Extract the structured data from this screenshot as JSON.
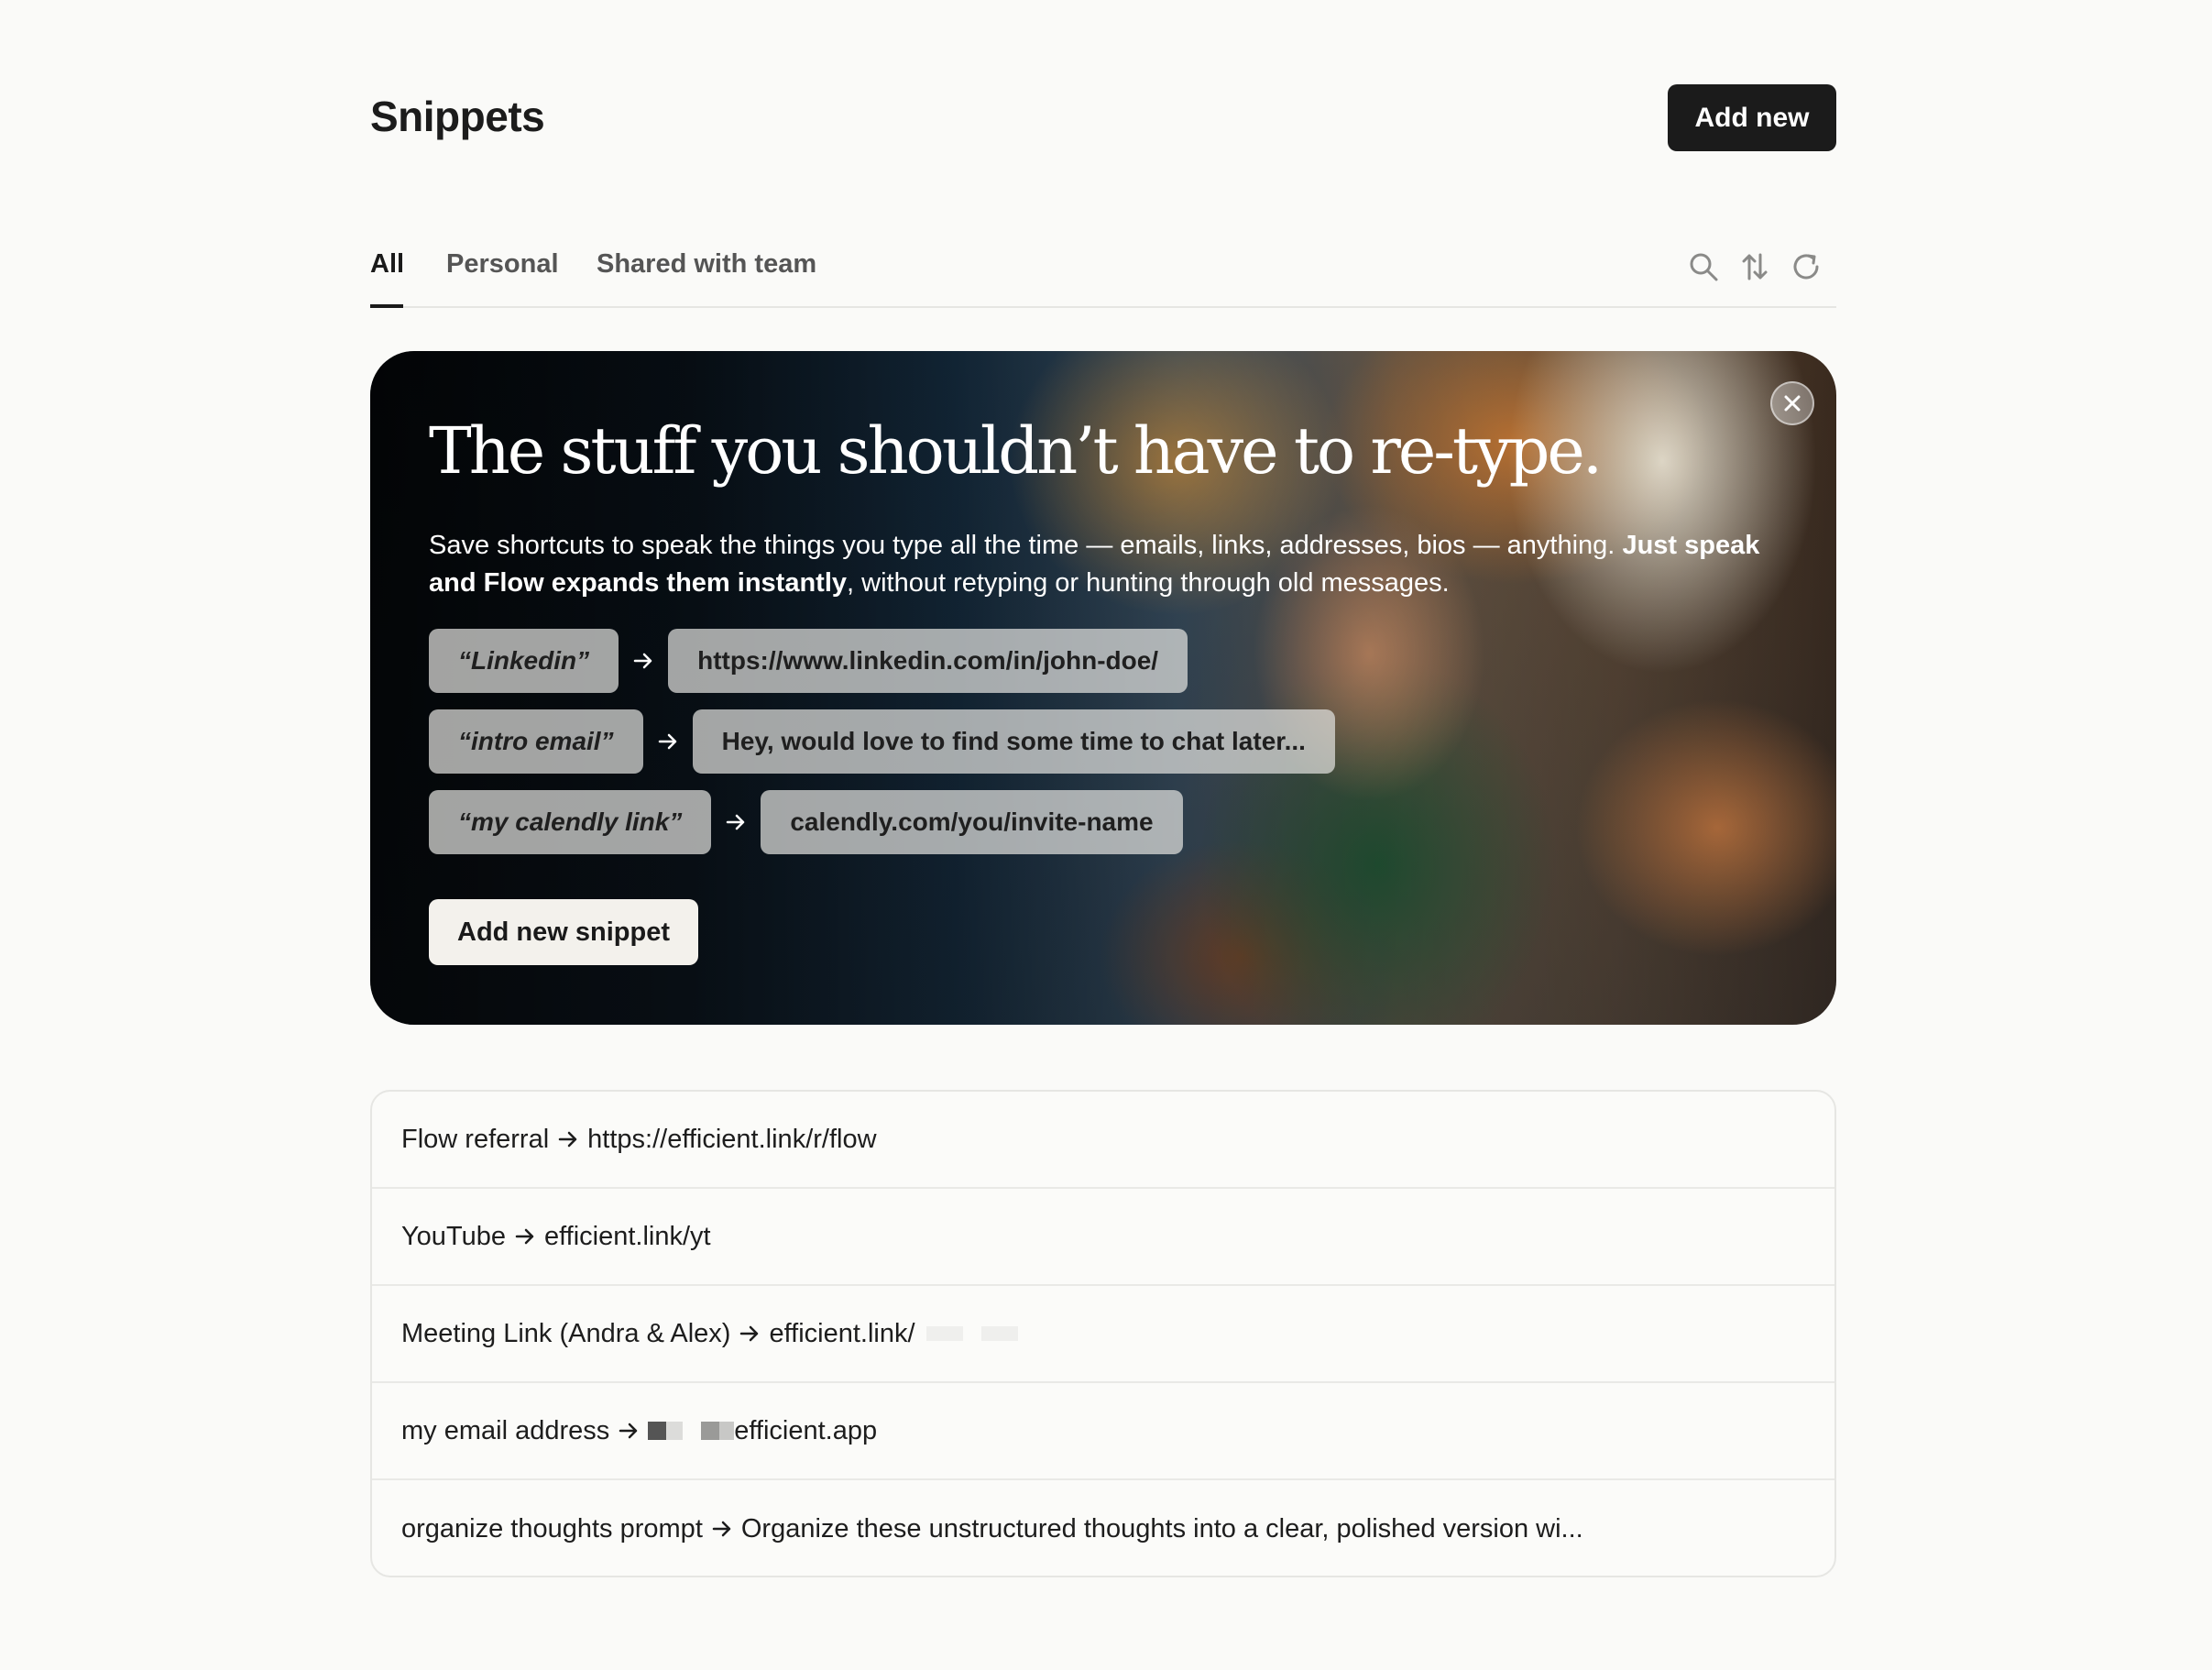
{
  "header": {
    "title": "Snippets",
    "add_new_label": "Add new"
  },
  "tabs": [
    {
      "label": "All",
      "active": true
    },
    {
      "label": "Personal",
      "active": false
    },
    {
      "label": "Shared with team",
      "active": false
    }
  ],
  "toolbar_icons": [
    "search-icon",
    "sort-icon",
    "refresh-icon"
  ],
  "hero": {
    "headline": "The stuff you shouldn’t have to re-type.",
    "desc_plain_1": "Save shortcuts to speak the things you type all the time — emails, links, addresses, bios — anything. ",
    "desc_bold": "Just speak and Flow expands them instantly",
    "desc_plain_2": ", without retyping or hunting through old messages.",
    "examples": [
      {
        "key": "“Linkedin”",
        "value": "https://www.linkedin.com/in/john-doe/"
      },
      {
        "key": "“intro email”",
        "value": "Hey, would love to find some time to chat later..."
      },
      {
        "key": "“my calendly link”",
        "value": "calendly.com/you/invite-name"
      }
    ],
    "cta_label": "Add new snippet",
    "close_icon": "close-icon"
  },
  "snippets": [
    {
      "trigger": "Flow referral",
      "expansion": "https://efficient.link/r/flow"
    },
    {
      "trigger": "YouTube",
      "expansion": "efficient.link/yt"
    },
    {
      "trigger": "Meeting Link (Andra & Alex)",
      "expansion": "efficient.link/"
    },
    {
      "trigger": "my email address",
      "expansion": "efficient.app"
    },
    {
      "trigger": "organize thoughts prompt",
      "expansion": "Organize these unstructured thoughts into a clear, polished version wi..."
    }
  ],
  "colors": {
    "primary_button": "#1b1b1b",
    "background": "#fafaf8",
    "divider": "#e6e6e3"
  }
}
